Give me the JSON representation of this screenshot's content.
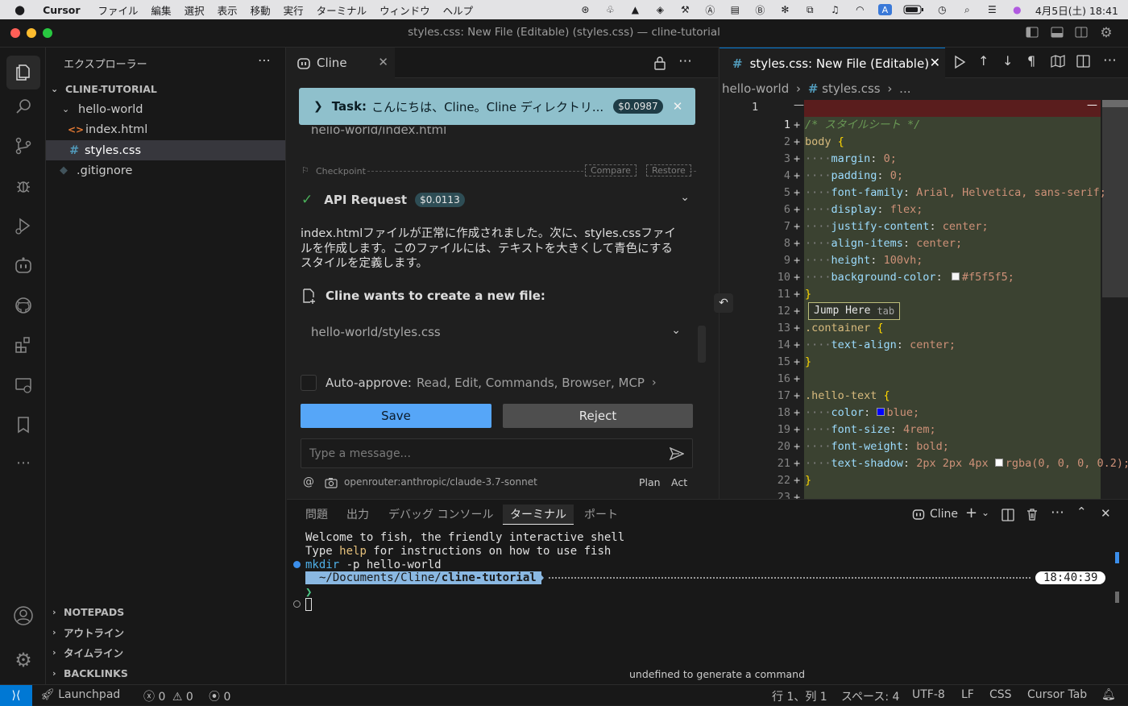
{
  "menubar": {
    "app_name": "Cursor",
    "items": [
      "ファイル",
      "編集",
      "選択",
      "表示",
      "移動",
      "実行",
      "ターミナル",
      "ウィンドウ",
      "ヘルプ"
    ],
    "clock": "4月5日(土) 18:41"
  },
  "window": {
    "title": "styles.css: New File (Editable) (styles.css) — cline-tutorial"
  },
  "explorer": {
    "title": "エクスプローラー",
    "root": "CLINE-TUTORIAL",
    "folder": "hello-world",
    "files": [
      "index.html",
      "styles.css",
      ".gitignore"
    ],
    "sections": [
      "NOTEPADS",
      "アウトライン",
      "タイムライン",
      "BACKLINKS"
    ]
  },
  "cline": {
    "tab_label": "Cline",
    "task_label": "Task:",
    "task_text": "こんにちは、Cline。Cline ディレクトリ...",
    "task_cost": "$0.0987",
    "prev_file": "hello-world/index.html",
    "checkpoint_label": "Checkpoint",
    "compare_label": "Compare",
    "restore_label": "Restore",
    "api_request_label": "API Request",
    "api_cost": "$0.0113",
    "message_line1": "index.htmlファイルが正常に作成されました。次に、styles.cssファイ",
    "message_line2": "ルを作成します。このファイルには、テキストを大きくして青色にする",
    "message_line3": "スタイルを定義します。",
    "new_file_label": "Cline wants to create a new file:",
    "new_file_path": "hello-world/styles.css",
    "auto_approve_label": "Auto-approve:",
    "auto_approve_value": "Read, Edit, Commands, Browser, MCP",
    "save_label": "Save",
    "reject_label": "Reject",
    "input_placeholder": "Type a message...",
    "model": "openrouter:anthropic/claude-3.7-sonnet",
    "plan_label": "Plan",
    "act_label": "Act"
  },
  "editor": {
    "tab_label": "styles.css: New File (Editable)",
    "breadcrumb_folder": "hello-world",
    "breadcrumb_file": "styles.css",
    "breadcrumb_more": "...",
    "left_line": "1",
    "jump_label": "Jump Here",
    "jump_key": "tab",
    "lines": [
      {
        "n": "1",
        "t": "/* スタイルシート */"
      },
      {
        "n": "2",
        "t": "body {"
      },
      {
        "n": "3",
        "t": "    margin: 0;"
      },
      {
        "n": "4",
        "t": "    padding: 0;"
      },
      {
        "n": "5",
        "t": "    font-family: Arial, Helvetica, sans-serif;"
      },
      {
        "n": "6",
        "t": "    display: flex;"
      },
      {
        "n": "7",
        "t": "    justify-content: center;"
      },
      {
        "n": "8",
        "t": "    align-items: center;"
      },
      {
        "n": "9",
        "t": "    height: 100vh;"
      },
      {
        "n": "10",
        "t": "    background-color: #f5f5f5;"
      },
      {
        "n": "11",
        "t": "}"
      },
      {
        "n": "12",
        "t": ""
      },
      {
        "n": "13",
        "t": ".container {"
      },
      {
        "n": "14",
        "t": "    text-align: center;"
      },
      {
        "n": "15",
        "t": "}"
      },
      {
        "n": "16",
        "t": ""
      },
      {
        "n": "17",
        "t": ".hello-text {"
      },
      {
        "n": "18",
        "t": "    color: blue;"
      },
      {
        "n": "19",
        "t": "    font-size: 4rem;"
      },
      {
        "n": "20",
        "t": "    font-weight: bold;"
      },
      {
        "n": "21",
        "t": "    text-shadow: 2px 2px 4px rgba(0, 0, 0, 0.2);"
      },
      {
        "n": "22",
        "t": "}"
      },
      {
        "n": "23",
        "t": ""
      }
    ]
  },
  "panel": {
    "tabs": [
      "問題",
      "出力",
      "デバッグ コンソール",
      "ターミナル",
      "ポート"
    ],
    "terminal_name": "Cline",
    "welcome": "Welcome to fish, the friendly interactive shell",
    "type_help_pre": "Type ",
    "type_help_word": "help",
    "type_help_post": " for instructions on how to use fish",
    "cmd": "mkdir",
    "cmd_args": " -p hello-world",
    "prompt_path": "~/Documents/Cline/",
    "prompt_dir": "cline-tutorial",
    "prompt_time": "18:40:39",
    "prompt_char": "❯",
    "hint": "undefined to generate a command"
  },
  "statusbar": {
    "launchpad": "Launchpad",
    "errors": "0",
    "warnings": "0",
    "ports": "0",
    "position": "行 1、列 1",
    "spaces": "スペース: 4",
    "encoding": "UTF-8",
    "eol": "LF",
    "language": "CSS",
    "cursor_tab": "Cursor Tab"
  },
  "colors": {
    "task_bg": "#8fc0cc",
    "save_btn": "#56a6f8",
    "diff_added": "#3b4231",
    "accent": "#0078d4"
  }
}
